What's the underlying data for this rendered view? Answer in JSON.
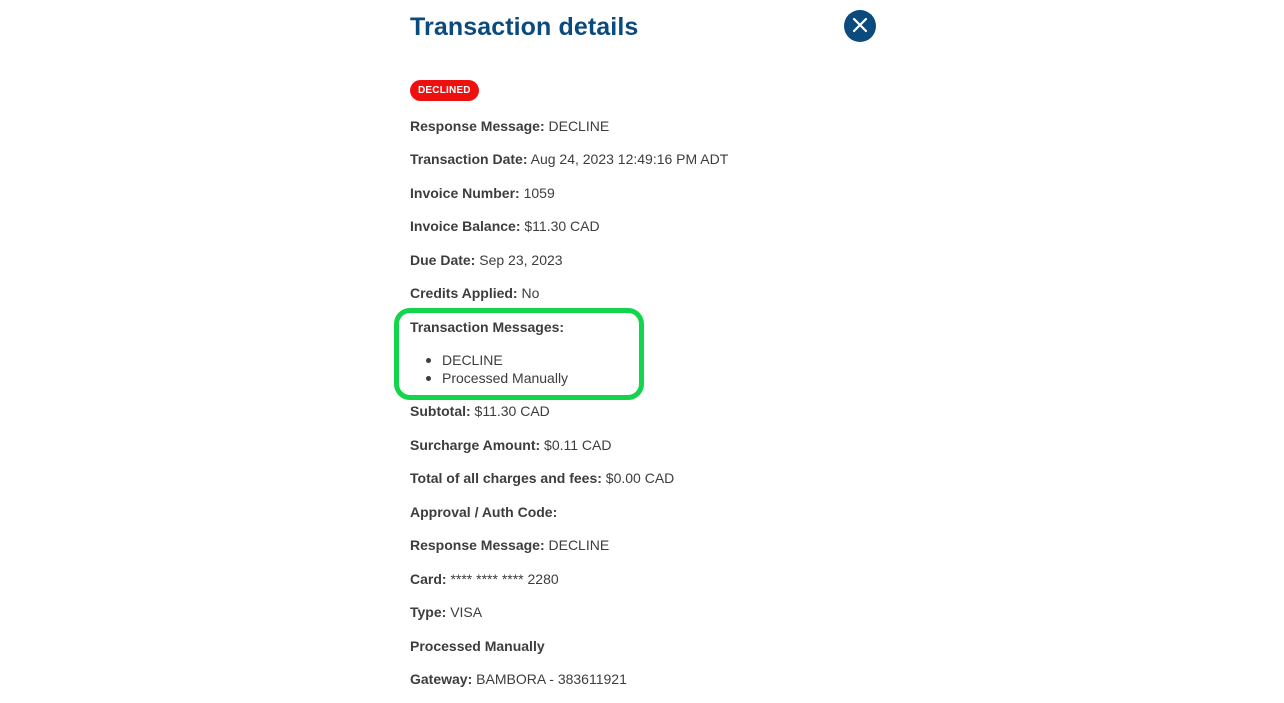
{
  "title": "Transaction details",
  "status_badge": "DECLINED",
  "colors": {
    "title": "#0b4a7d",
    "badge": "#ee0f0f",
    "highlight": "#12d54b"
  },
  "icons": {
    "close": "close-icon"
  },
  "fields": {
    "response_message_1": {
      "label": "Response Message:",
      "value": "DECLINE"
    },
    "transaction_date": {
      "label": "Transaction Date:",
      "value": "Aug 24, 2023 12:49:16 PM ADT"
    },
    "invoice_number": {
      "label": "Invoice Number:",
      "value": "1059"
    },
    "invoice_balance": {
      "label": "Invoice Balance:",
      "value": "$11.30 CAD"
    },
    "due_date": {
      "label": "Due Date:",
      "value": "Sep 23, 2023"
    },
    "credits_applied": {
      "label": "Credits Applied:",
      "value": "No"
    },
    "transaction_messages": {
      "label": "Transaction Messages:",
      "items": [
        "DECLINE",
        "Processed Manually"
      ]
    },
    "subtotal": {
      "label": "Subtotal:",
      "value": "$11.30 CAD"
    },
    "surcharge_amount": {
      "label": "Surcharge Amount:",
      "value": "$0.11 CAD"
    },
    "total_charges": {
      "label": "Total of all charges and fees:",
      "value": "$0.00 CAD"
    },
    "approval_code": {
      "label": "Approval / Auth Code:",
      "value": ""
    },
    "response_message_2": {
      "label": "Response Message:",
      "value": "DECLINE"
    },
    "card": {
      "label": "Card:",
      "value": "**** **** **** 2280"
    },
    "type": {
      "label": "Type:",
      "value": "VISA"
    },
    "processed_manually": {
      "label": "Processed Manually"
    },
    "gateway": {
      "label": "Gateway:",
      "value": "BAMBORA - 383611921"
    }
  }
}
